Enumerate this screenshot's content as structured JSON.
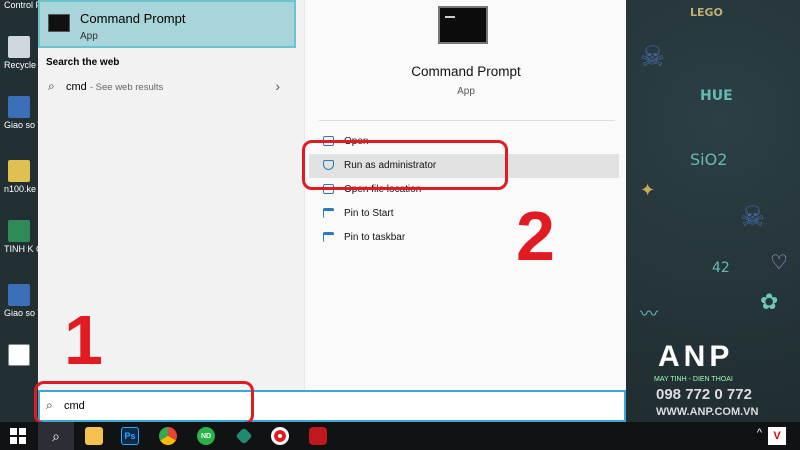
{
  "desktop": {
    "icons": [
      {
        "label": "Control P"
      },
      {
        "label": "Recycle"
      },
      {
        "label": "Giao so TKMH-c"
      },
      {
        "label": "n100.ke"
      },
      {
        "label": "TINH K CAU AC"
      },
      {
        "label": "Giao so TKMH-c"
      }
    ],
    "wallpaper_words": [
      "HUE",
      "SiO2",
      "42",
      "LEGO"
    ]
  },
  "start_left": {
    "best_match": {
      "title": "Command Prompt",
      "subtitle": "App"
    },
    "web_heading": "Search the web",
    "web_result": {
      "query": "cmd",
      "hint": "- See web results"
    }
  },
  "start_right": {
    "app_title": "Command Prompt",
    "app_subtitle": "App",
    "actions": [
      {
        "label": "Open",
        "icon": "open-icon"
      },
      {
        "label": "Run as administrator",
        "icon": "shield-icon"
      },
      {
        "label": "Open file location",
        "icon": "folder-icon"
      },
      {
        "label": "Pin to Start",
        "icon": "pin-icon"
      },
      {
        "label": "Pin to taskbar",
        "icon": "pin-icon"
      }
    ]
  },
  "search": {
    "value": "cmd"
  },
  "annotations": {
    "step1": "1",
    "step2": "2",
    "color": "#e11b22"
  },
  "watermark": {
    "letters": "ANP",
    "tagline": "MAY TINH - DIEN THOAI",
    "phone": "098 772 0 772",
    "site": "WWW.ANP.COM.VN"
  },
  "taskbar": {
    "apps": [
      {
        "name": "file-explorer",
        "label": ""
      },
      {
        "name": "photoshop",
        "label": "Ps"
      },
      {
        "name": "chrome",
        "label": ""
      },
      {
        "name": "nd-app",
        "label": "ND"
      },
      {
        "name": "pen-app",
        "label": ""
      },
      {
        "name": "record-app",
        "label": ""
      },
      {
        "name": "game-app",
        "label": ""
      }
    ],
    "tray_badge": "V"
  },
  "colors": {
    "accent": "#3aa7d9",
    "highlight": "#a8d5d9",
    "annotation": "#e11b22"
  }
}
